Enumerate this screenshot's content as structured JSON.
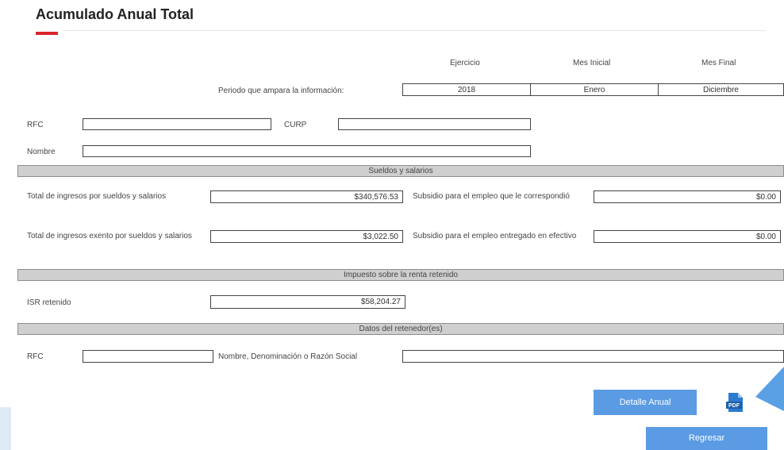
{
  "title": "Acumulado Anual Total",
  "period": {
    "label": "Periodo que ampara la información:",
    "headers": [
      "Ejercicio",
      "Mes Inicial",
      "Mes Final"
    ],
    "values": [
      "2018",
      "Enero",
      "Diciembre"
    ]
  },
  "identity": {
    "rfc_label": "RFC",
    "curp_label": "CURP",
    "nombre_label": "Nombre",
    "rfc_value": "",
    "curp_value": "",
    "nombre_value": ""
  },
  "sueldos": {
    "header": "Sueldos y salarios",
    "total_ingresos_label": "Total de ingresos por sueldos y salarios",
    "total_ingresos_value": "$340,576.53",
    "subsidio_corresp_label": "Subsidio para el empleo que le correspondió",
    "subsidio_corresp_value": "$0.00",
    "total_exento_label": "Total de ingresos exento por sueldos y salarios",
    "total_exento_value": "$3,022.50",
    "subsidio_entregado_label": "Subsidio para el empleo entregado en efectivo",
    "subsidio_entregado_value": "$0.00"
  },
  "isr": {
    "header": "Impuesto sobre la renta retenido",
    "label": "ISR retenido",
    "value": "$58,204.27"
  },
  "retenedor": {
    "header": "Datos del retenedor(es)",
    "rfc_label": "RFC",
    "rfc_value": "",
    "nombre_label": "Nombre, Denominación o Razón Social",
    "nombre_value": ""
  },
  "buttons": {
    "detalle": "Detalle Anual",
    "regresar": "Regresar"
  },
  "pdf_icon_label": "PDF",
  "colors": {
    "accent": "#d9262c",
    "button": "#5b9be3",
    "band": "#cfcfcf"
  }
}
